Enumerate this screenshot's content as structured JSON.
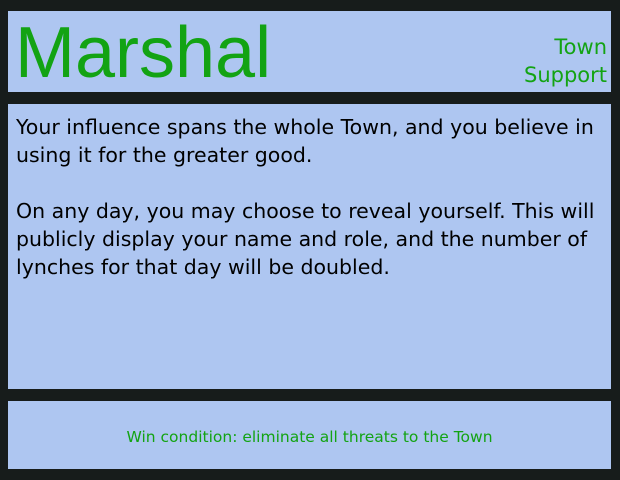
{
  "role_card": {
    "name": "Marshal",
    "alignment": {
      "faction": "Town",
      "category": "Support"
    },
    "description": [
      "Your influence spans the whole Town, and you believe in using it for the greater good.",
      "On any day, you may choose to reveal yourself. This will publicly display your name and role, and the number of lynches for that day will be doubled."
    ],
    "win_condition": "Win condition: eliminate all threats to the Town"
  },
  "colors": {
    "background": "#171c1b",
    "panel": "#aec6f1",
    "accent_green": "#13a313",
    "text": "#000000"
  }
}
